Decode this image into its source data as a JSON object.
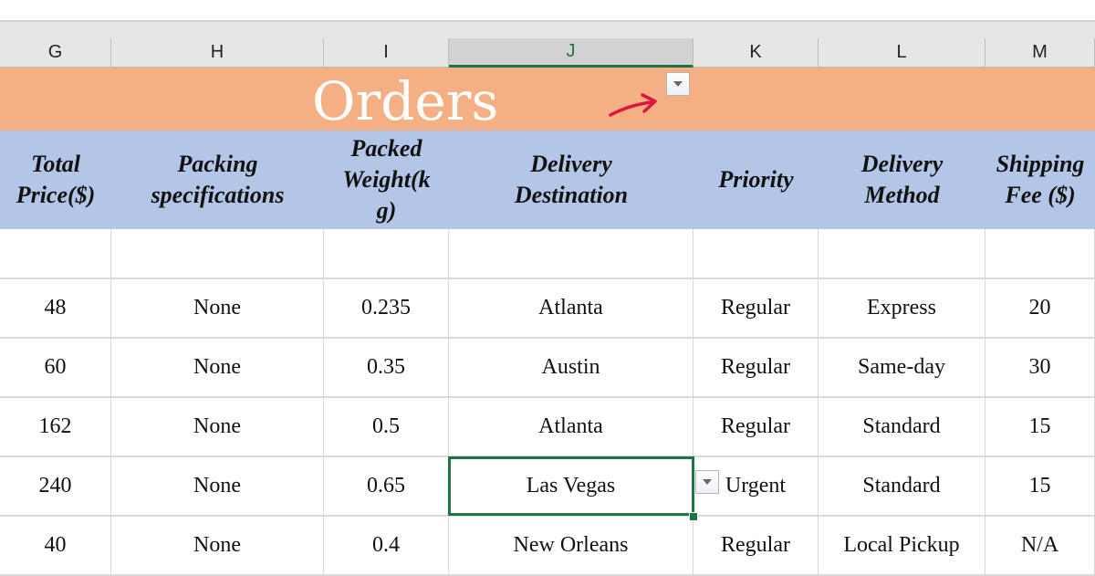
{
  "columns": [
    {
      "letter": "G",
      "selected": false
    },
    {
      "letter": "H",
      "selected": false
    },
    {
      "letter": "I",
      "selected": false
    },
    {
      "letter": "J",
      "selected": true
    },
    {
      "letter": "K",
      "selected": false
    },
    {
      "letter": "L",
      "selected": false
    },
    {
      "letter": "M",
      "selected": false
    }
  ],
  "title": "Orders",
  "accent_colors": {
    "title_fill": "#f4b084",
    "header_fill": "#b4c6e7",
    "selection": "#217346",
    "annotation_arrow": "#e0143c"
  },
  "headers": [
    "Total\nPrice($)",
    "Packing\nspecifications",
    "Packed\nWeight(k\ng)",
    "Delivery\nDestination",
    "Priority",
    "Delivery\nMethod",
    "Shipping\nFee ($)"
  ],
  "rows": [
    [
      "",
      "",
      "",
      "",
      "",
      "",
      ""
    ],
    [
      "48",
      "None",
      "0.235",
      "Atlanta",
      "Regular",
      "Express",
      "20"
    ],
    [
      "60",
      "None",
      "0.35",
      "Austin",
      "Regular",
      "Same-day",
      "30"
    ],
    [
      "162",
      "None",
      "0.5",
      "Atlanta",
      "Regular",
      "Standard",
      "15"
    ],
    [
      "240",
      "None",
      "0.65",
      "Las Vegas",
      "Urgent",
      "Standard",
      "15"
    ],
    [
      "40",
      "None",
      "0.4",
      "New Orleans",
      "Regular",
      "Local Pickup",
      "N/A"
    ]
  ],
  "selected_cell": {
    "row": 4,
    "col": 3
  },
  "icons": {
    "filter_dropdown": "dropdown-arrow-icon",
    "annotation": "red-arrow-icon"
  }
}
